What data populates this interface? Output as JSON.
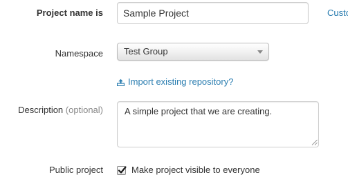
{
  "project_name": {
    "label": "Project name is",
    "value": "Sample Project",
    "customize_link": "Custo"
  },
  "namespace": {
    "label": "Namespace",
    "selected": "Test Group",
    "arrow_icon": "chevron-down-icon"
  },
  "import": {
    "label": "Import existing repository?",
    "icon": "upload-icon",
    "color": "#2a7db0"
  },
  "description": {
    "label": "Description",
    "optional": "(optional)",
    "value": "A simple project that we are creating."
  },
  "public_project": {
    "label": "Public project",
    "checkbox_label": "Make project visible to everyone",
    "checked": true
  }
}
